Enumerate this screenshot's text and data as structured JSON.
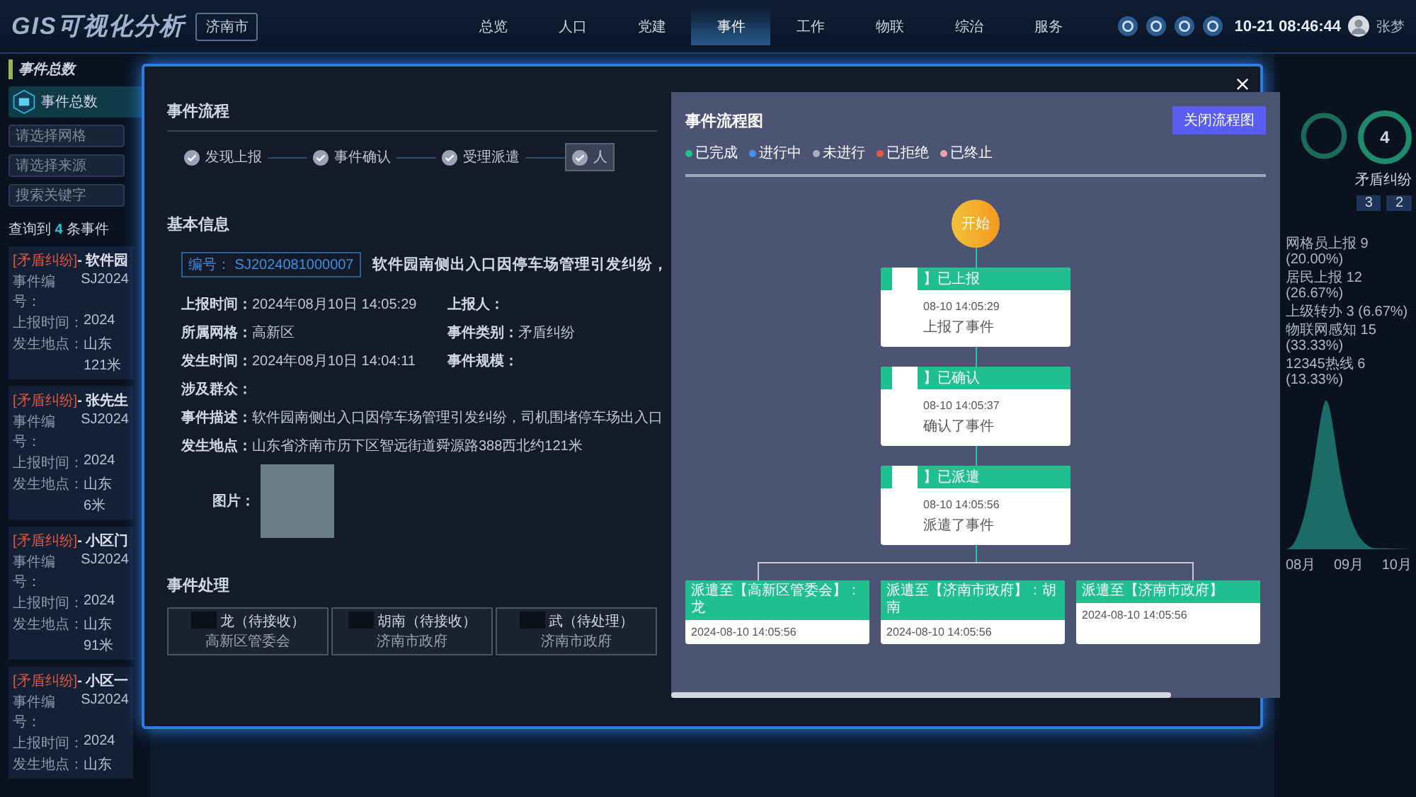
{
  "header": {
    "logo": "GIS可视化分析",
    "city": "济南市",
    "nav": [
      {
        "label": "总览",
        "selected": false
      },
      {
        "label": "人口",
        "selected": false
      },
      {
        "label": "党建",
        "selected": false
      },
      {
        "label": "事件",
        "selected": true
      },
      {
        "label": "工作",
        "selected": false
      },
      {
        "label": "物联",
        "selected": false
      },
      {
        "label": "综治",
        "selected": false
      },
      {
        "label": "服务",
        "selected": false
      }
    ],
    "time": "10-21 08:46:44",
    "user": "张梦"
  },
  "sidebar": {
    "title": "事件总数",
    "stat_label": "事件总数",
    "filters": [
      {
        "placeholder": "请选择网格"
      },
      {
        "placeholder": "请选择来源"
      }
    ],
    "search": {
      "placeholder": "搜索关键字"
    },
    "result": {
      "prefix": "查询到",
      "count": "4",
      "suffix": "条事件"
    },
    "events": [
      {
        "tag": "[矛盾纠纷]",
        "title": "- 软件园",
        "rows": [
          {
            "label": "事件编号：",
            "value": "SJ2024"
          },
          {
            "label": "上报时间：",
            "value": "2024"
          },
          {
            "label": "发生地点：",
            "value": "山东"
          }
        ],
        "extra": "121米"
      },
      {
        "tag": "[矛盾纠纷]",
        "title": "- 张先生",
        "rows": [
          {
            "label": "事件编号：",
            "value": "SJ2024"
          },
          {
            "label": "上报时间：",
            "value": "2024"
          },
          {
            "label": "发生地点：",
            "value": "山东"
          }
        ],
        "extra": "6米"
      },
      {
        "tag": "[矛盾纠纷]",
        "title": "- 小区门",
        "rows": [
          {
            "label": "事件编号：",
            "value": "SJ2024"
          },
          {
            "label": "上报时间：",
            "value": "2024"
          },
          {
            "label": "发生地点：",
            "value": "山东"
          }
        ],
        "extra": "91米"
      },
      {
        "tag": "[矛盾纠纷]",
        "title": "- 小区一",
        "rows": [
          {
            "label": "事件编号：",
            "value": "SJ2024"
          },
          {
            "label": "上报时间：",
            "value": "2024"
          },
          {
            "label": "发生地点：",
            "value": "山东"
          }
        ]
      }
    ]
  },
  "right_panel": {
    "ring_value": "4",
    "ring_label": "矛盾纠纷",
    "stats": [
      "3",
      "2"
    ],
    "legend": [
      "网格员上报 9 (20.00%)",
      "居民上报 12 (26.67%)",
      "上级转办 3 (6.67%)",
      "物联网感知 15 (33.33%)",
      "12345热线 6 (13.33%)"
    ],
    "months": [
      "08月",
      "09月",
      "10月"
    ]
  },
  "modal": {
    "process_title": "事件流程",
    "steps": [
      {
        "label": "发现上报",
        "selected": false
      },
      {
        "label": "事件确认",
        "selected": false
      },
      {
        "label": "受理派遣",
        "selected": false
      },
      {
        "label": "人",
        "selected": true
      }
    ],
    "basic_title": "基本信息",
    "code": "编号： SJ2024081000007",
    "event_title": "软件园南侧出入口因停车场管理引发纠纷，",
    "fields": [
      {
        "label": "上报时间：",
        "value": "2024年08月10日 14:05:29"
      },
      {
        "label": "上报人："
      },
      {
        "label": "所属网格：",
        "value": "高新区"
      },
      {
        "label": "事件类别：",
        "value": "矛盾纠纷"
      },
      {
        "label": "发生时间：",
        "value": "2024年08月10日 14:04:11"
      },
      {
        "label": "事件规模："
      }
    ],
    "long_fields": [
      {
        "label": "涉及群众："
      },
      {
        "label": "事件描述：",
        "value": "软件园南侧出入口因停车场管理引发纠纷，司机围堵停车场出入口"
      },
      {
        "label": "发生地点：",
        "value": "山东省济南市历下区智远街道舜源路388西北约121米"
      }
    ],
    "photo_label": "图片：",
    "handling_title": "事件处理",
    "handlers": [
      {
        "name": "龙（待接收）",
        "org": "高新区管委会"
      },
      {
        "name": "胡南（待接收）",
        "org": "济南市政府"
      },
      {
        "name": "武（待处理）",
        "org": "济南市政府"
      }
    ]
  },
  "flow": {
    "title": "事件流程图",
    "close_button": "关闭流程图",
    "legend": [
      {
        "label": "已完成",
        "color": "#1fc08e"
      },
      {
        "label": "进行中",
        "color": "#4a8cf0"
      },
      {
        "label": "未进行",
        "color": "#a9adbd"
      },
      {
        "label": "已拒绝",
        "color": "#e35b48"
      },
      {
        "label": "已终止",
        "color": "#e6a3a8"
      }
    ],
    "start": "开始",
    "nodes": [
      {
        "title": "】已上报",
        "time": "08-10 14:05:29",
        "text": "上报了事件"
      },
      {
        "title": "】已确认",
        "time": "08-10 14:05:37",
        "text": "确认了事件"
      },
      {
        "title": "】已派遣",
        "time": "08-10 14:05:56",
        "text": "派遣了事件"
      }
    ],
    "branches": [
      {
        "title": "派遣至【高新区管委会】：龙",
        "time": "2024-08-10 14:05:56"
      },
      {
        "title": "派遣至【济南市政府】：胡南",
        "time": "2024-08-10 14:05:56"
      },
      {
        "title": "派遣至【济南市政府】",
        "time": "2024-08-10 14:05:56"
      }
    ]
  }
}
